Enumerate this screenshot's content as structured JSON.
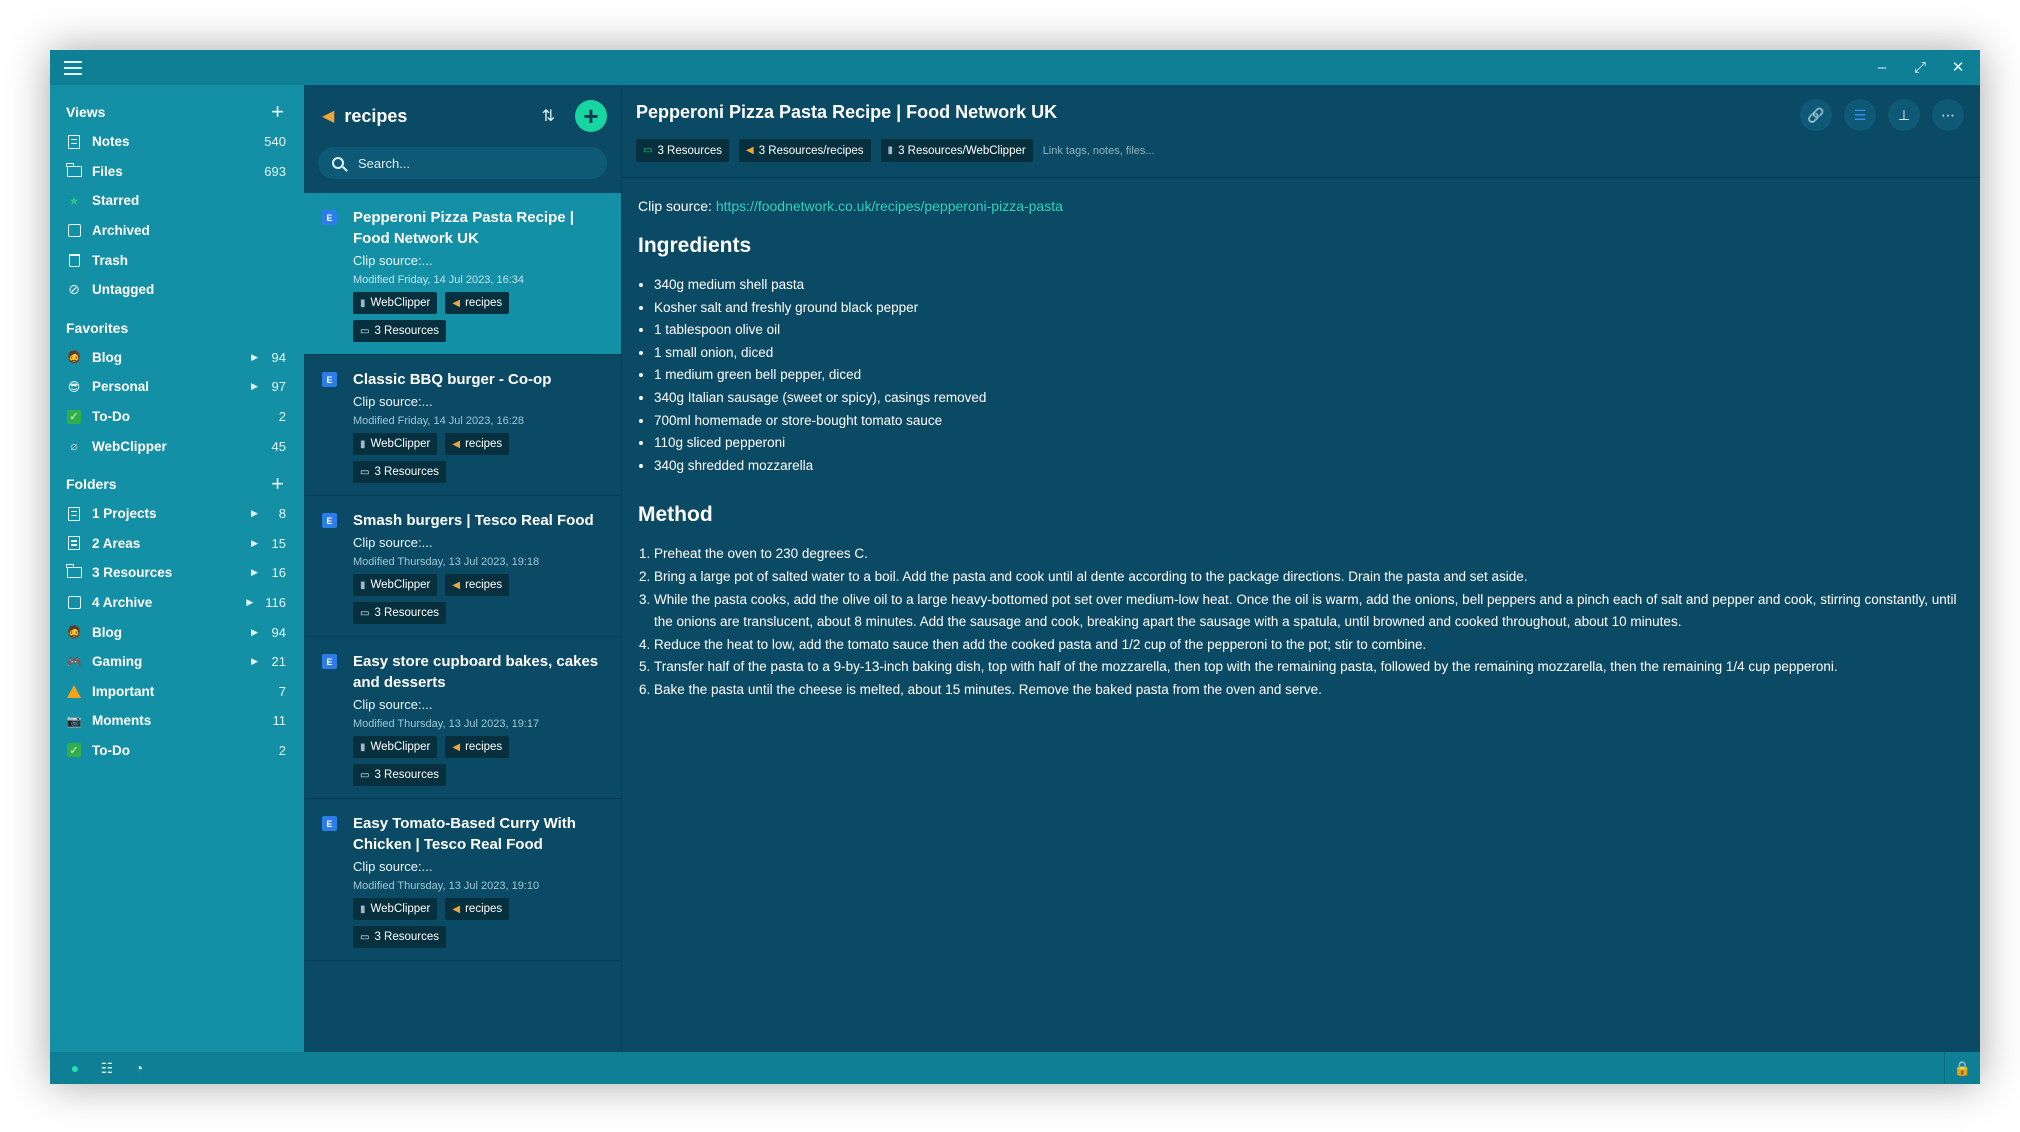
{
  "sidebar": {
    "views": {
      "title": "Views",
      "items": [
        {
          "label": "Notes",
          "count": "540",
          "icon": "document-icon"
        },
        {
          "label": "Files",
          "count": "693",
          "icon": "folder-icon"
        },
        {
          "label": "Starred",
          "count": "",
          "icon": "star-icon"
        },
        {
          "label": "Archived",
          "count": "",
          "icon": "archive-icon"
        },
        {
          "label": "Trash",
          "count": "",
          "icon": "trash-icon"
        },
        {
          "label": "Untagged",
          "count": "",
          "icon": "untagged-icon"
        }
      ]
    },
    "favorites": {
      "title": "Favorites",
      "items": [
        {
          "label": "Blog",
          "count": "94",
          "emoji": "🧔"
        },
        {
          "label": "Personal",
          "count": "97",
          "emoji": "😎"
        },
        {
          "label": "To-Do",
          "count": "2",
          "emoji": "✔"
        },
        {
          "label": "WebClipper",
          "count": "45",
          "emoji": "📎"
        }
      ]
    },
    "folders": {
      "title": "Folders",
      "items": [
        {
          "label": "1 Projects",
          "count": "8"
        },
        {
          "label": "2 Areas",
          "count": "15"
        },
        {
          "label": "3 Resources",
          "count": "16"
        },
        {
          "label": "4 Archive",
          "count": "116"
        },
        {
          "label": "Blog",
          "count": "94"
        },
        {
          "label": "Gaming",
          "count": "21"
        },
        {
          "label": "Important",
          "count": "7"
        },
        {
          "label": "Moments",
          "count": "11"
        },
        {
          "label": "To-Do",
          "count": "2"
        }
      ]
    }
  },
  "notelist": {
    "title": "recipes",
    "search_placeholder": "Search...",
    "notes": [
      {
        "title": "Pepperoni Pizza Pasta Recipe | Food Network UK",
        "snippet": "Clip source:...",
        "date": "Modified Friday, 14 Jul 2023, 16:34",
        "tags": [
          "WebClipper",
          "recipes"
        ],
        "folder": "3 Resources"
      },
      {
        "title": "Classic BBQ burger - Co-op",
        "snippet": "Clip source:...",
        "date": "Modified Friday, 14 Jul 2023, 16:28",
        "tags": [
          "WebClipper",
          "recipes"
        ],
        "folder": "3 Resources"
      },
      {
        "title": "Smash burgers | Tesco Real Food",
        "snippet": "Clip source:...",
        "date": "Modified Thursday, 13 Jul 2023, 19:18",
        "tags": [
          "WebClipper",
          "recipes"
        ],
        "folder": "3 Resources"
      },
      {
        "title": "Easy store cupboard bakes, cakes and desserts",
        "snippet": "Clip source:...",
        "date": "Modified Thursday, 13 Jul 2023, 19:17",
        "tags": [
          "WebClipper",
          "recipes"
        ],
        "folder": "3 Resources"
      },
      {
        "title": "Easy Tomato-Based Curry With Chicken | Tesco Real Food",
        "snippet": "Clip source:...",
        "date": "Modified Thursday, 13 Jul 2023, 19:10",
        "tags": [
          "WebClipper",
          "recipes"
        ],
        "folder": "3 Resources"
      }
    ]
  },
  "editor": {
    "title": "Pepperoni Pizza Pasta Recipe | Food Network UK",
    "chips": [
      "3 Resources",
      "3 Resources/recipes",
      "3 Resources/WebClipper"
    ],
    "link_hint": "Link tags, notes, files...",
    "clip_label": "Clip source: ",
    "clip_url": "https://foodnetwork.co.uk/recipes/pepperoni-pizza-pasta",
    "ingredients_heading": "Ingredients",
    "ingredients": [
      "340g medium shell pasta",
      "Kosher salt and freshly ground black pepper",
      "1 tablespoon olive oil",
      "1 small onion, diced",
      "1 medium green bell pepper, diced",
      "340g Italian sausage (sweet or spicy), casings removed",
      "700ml homemade or store-bought tomato sauce",
      "110g sliced pepperoni",
      "340g shredded mozzarella"
    ],
    "method_heading": "Method",
    "method": [
      "Preheat the oven to 230 degrees C.",
      "Bring a large pot of salted water to a boil. Add the pasta and cook until al dente according to the package directions. Drain the pasta and set aside.",
      "While the pasta cooks, add the olive oil to a large heavy-bottomed pot set over medium-low heat. Once the oil is warm, add the onions, bell peppers and a pinch each of salt and pepper and cook, stirring constantly, until the onions are translucent, about 8 minutes. Add the sausage and cook, breaking apart the sausage with a spatula, until browned and cooked throughout, about 10 minutes.",
      "Reduce the heat to low, add the tomato sauce then add the cooked pasta and 1/2 cup of the pepperoni to the pot; stir to combine.",
      "Transfer half of the pasta to a 9-by-13-inch baking dish, top with half of the mozzarella, then top with the remaining pasta, followed by the remaining mozzarella, then the remaining 1/4 cup pepperoni.",
      "Bake the pasta until the cheese is melted, about 15 minutes. Remove the baked pasta from the oven and serve."
    ]
  },
  "colors": {
    "accent": "#18d5a1",
    "sidebar_bg": "#1390a6",
    "main_bg": "#0b4a64",
    "link": "#2fd1b8"
  }
}
